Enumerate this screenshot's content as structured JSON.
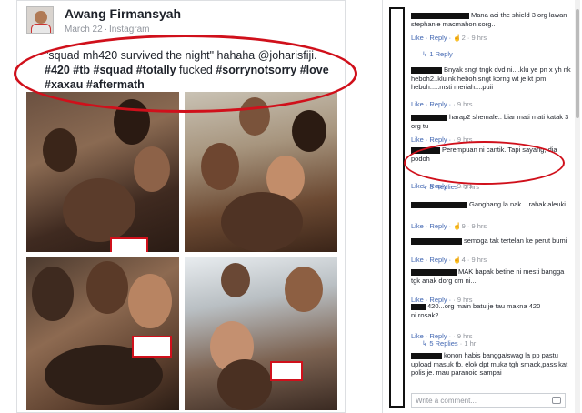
{
  "post": {
    "author": "Awang Firmansyah",
    "date": "March 22",
    "via": "Instagram",
    "caption_parts": [
      {
        "t": "\"squad mh420 survived the night\" hahaha @joharisfiji. ",
        "b": false
      },
      {
        "t": "#420 ",
        "b": true
      },
      {
        "t": "#tb ",
        "b": true
      },
      {
        "t": "#squad ",
        "b": true
      },
      {
        "t": "#totally ",
        "b": true
      },
      {
        "t": "fucked ",
        "b": false
      },
      {
        "t": "#sorrynotsorry ",
        "b": true
      },
      {
        "t": "#love ",
        "b": true
      },
      {
        "t": "#xaxau ",
        "b": true
      },
      {
        "t": "#aftermath",
        "b": true
      }
    ]
  },
  "comments": [
    {
      "text": "Mana aci the shield 3 org lawan stephanie macmahon sorg..",
      "actions": "Like · Reply ·",
      "likes": "2",
      "time": "9 hrs"
    },
    {
      "text": "Bnyak sngt tngk dvd ni....klu ye pn x yh nk heboh2..klu nk heboh sngt korng wt je kt jom heboh.....msti meriah....puii",
      "actions": "Like · Reply ·",
      "likes": "",
      "time": "9 hrs"
    },
    {
      "text": "harap2 shemale.. biar mati mati katak 3 org tu",
      "actions": "Like · Reply ·",
      "likes": "",
      "time": "9 hrs"
    },
    {
      "text": "Perempuan ni cantik. Tapi sayang, dia podoh",
      "actions": "Like · Reply ·",
      "likes": "",
      "time": "9 hrs"
    },
    {
      "text": "Gangbang la nak... rabak aleuki...",
      "actions": "Like · Reply ·",
      "likes": "9",
      "time": "9 hrs"
    },
    {
      "text": "semoga tak tertelan ke perut bumi",
      "actions": "Like · Reply ·",
      "likes": "4",
      "time": "9 hrs"
    },
    {
      "text": "MAK bapak betine ni mesti bangga tgk anak dorg cm ni...",
      "actions": "Like · Reply ·",
      "likes": "",
      "time": "9 hrs"
    },
    {
      "text": "420...org main batu je tau makna 420 ni.rosak2..",
      "actions": "Like · Reply ·",
      "likes": "",
      "time": "9 hrs"
    },
    {
      "text": "konon habis bangga/swag la pp pastu upload masuk fb. elok dpt muka tgh smack,pass kat polis je. mau paranoid sampai",
      "actions": "",
      "likes": "",
      "time": ""
    }
  ],
  "reply_links": [
    {
      "label": "1 Reply",
      "time": ""
    },
    {
      "label": "3 Replies",
      "time": "2 hrs"
    },
    {
      "label": "5 Replies",
      "time": "1 hr"
    }
  ],
  "compose_placeholder": "Write a comment..."
}
